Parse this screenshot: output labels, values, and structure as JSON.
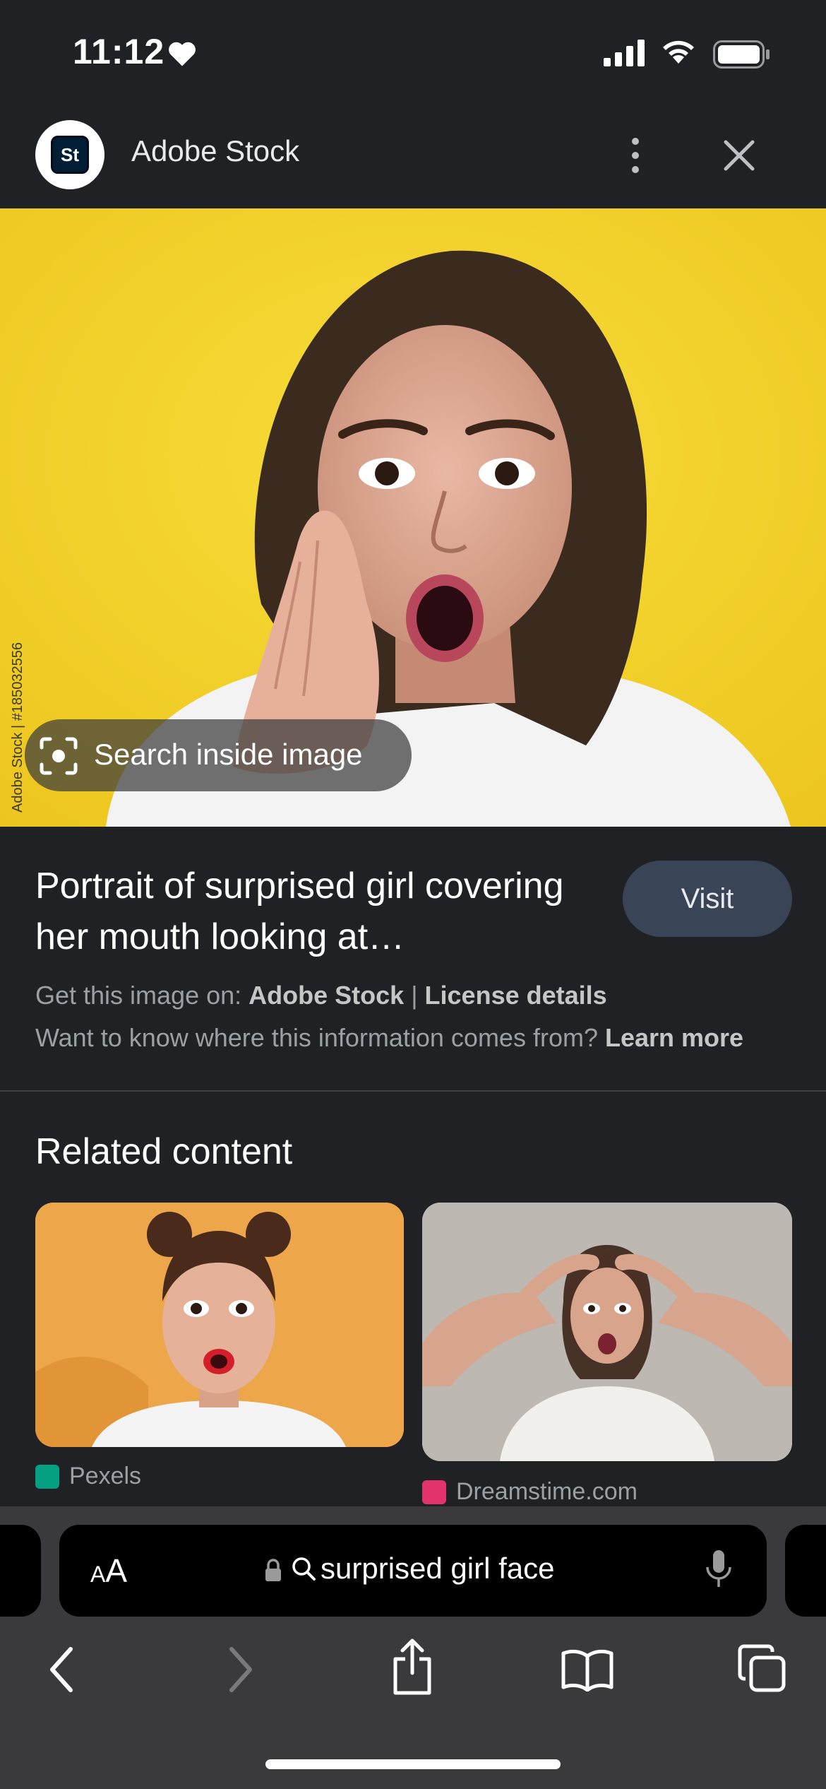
{
  "status_bar": {
    "time": "11:12",
    "icons": [
      "heart-icon",
      "signal-icon",
      "wifi-icon",
      "battery-icon"
    ]
  },
  "header": {
    "logo_text": "St",
    "site_name": "Adobe Stock",
    "icons": [
      "more-vert-icon",
      "close-icon"
    ]
  },
  "main_image": {
    "side_watermark": "Adobe Stock | #185032556",
    "search_inside_label": "Search inside image"
  },
  "info": {
    "title": "Portrait of surprised girl covering her mouth looking at…",
    "visit_label": "Visit",
    "get_image_prefix": "Get this image on: ",
    "source_name": "Adobe Stock",
    "separator": " | ",
    "license_label": "License details",
    "where_info_text": "Want to know where this information comes from? ",
    "learn_more_label": "Learn more"
  },
  "related": {
    "heading": "Related content",
    "items": [
      {
        "source": "Pexels",
        "favicon_color": "#05a081"
      },
      {
        "source": "Dreamstime.com",
        "favicon_color": "#e3336c"
      }
    ]
  },
  "browser": {
    "text_size_label_big": "A",
    "text_size_label_small": "A",
    "address_text": "surprised girl face",
    "icons": [
      "back-icon",
      "forward-icon",
      "share-icon",
      "bookmarks-icon",
      "tabs-icon"
    ]
  },
  "colors": {
    "background": "#202124",
    "image_background": "#f5d32b",
    "visit_button": "#394457",
    "toolbar": "#3a3a3c"
  }
}
